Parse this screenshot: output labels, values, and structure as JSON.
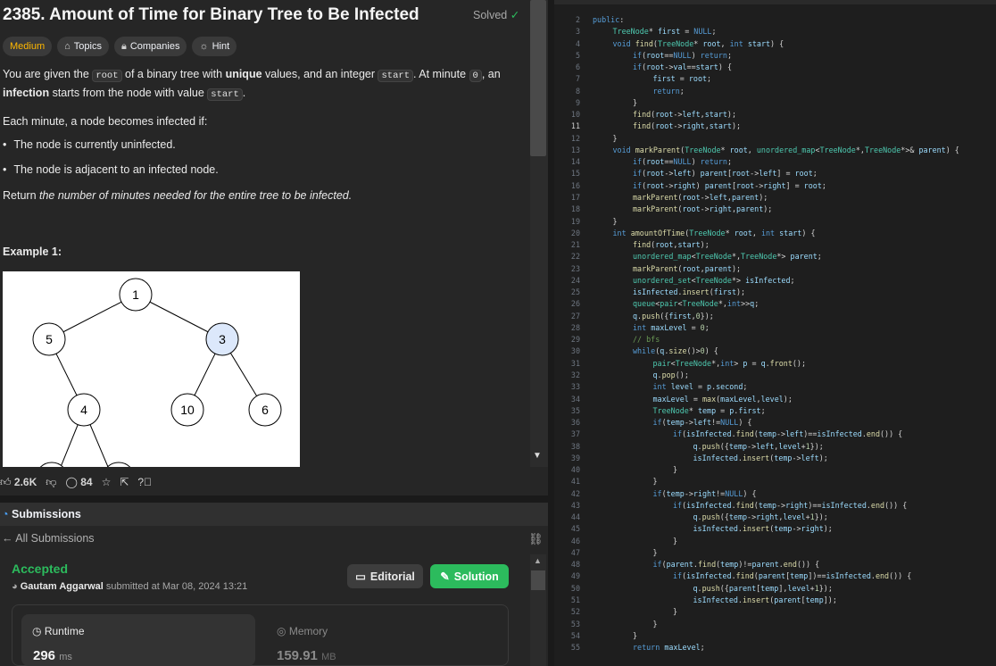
{
  "problem": {
    "title": "2385. Amount of Time for Binary Tree to Be Infected",
    "status": "Solved",
    "tags": [
      {
        "label": "Medium",
        "icon": ""
      },
      {
        "label": "Topics",
        "icon": "tag-icon"
      },
      {
        "label": "Companies",
        "icon": "lock-icon"
      },
      {
        "label": "Hint",
        "icon": "lightbulb-icon"
      }
    ],
    "desc": {
      "p1a": "You are given the ",
      "p1code1": "root",
      "p1b": " of a binary tree with ",
      "p1bold1": "unique",
      "p1c": " values, and an integer ",
      "p1code2": "start",
      "p1d": ". At minute ",
      "p1code3": "0",
      "p1e": ", an ",
      "p1bold2": "infection",
      "p1f": " starts from the node with value ",
      "p1code4": "start",
      "p1g": ".",
      "p2": "Each minute, a node becomes infected if:",
      "bullets": [
        "The node is currently uninfected.",
        "The node is adjacent to an infected node."
      ],
      "ret_a": "Return ",
      "ret_b": "the number of minutes needed for the entire tree to be infected."
    },
    "example_label": "Example 1:",
    "tree": {
      "nodes": [
        "1",
        "5",
        "3",
        "4",
        "10",
        "6"
      ],
      "infected_color": "#dce8fb"
    },
    "actions": {
      "likes": "2.6K",
      "comments": "84"
    }
  },
  "submission": {
    "header": "Submissions",
    "back_label": "All Submissions",
    "status": "Accepted",
    "author": "Gautam Aggarwal",
    "submitted_text": "submitted at Mar 08, 2024 13:21",
    "editorial_label": "Editorial",
    "solution_label": "Solution",
    "runtime_label": "Runtime",
    "runtime_value": "296",
    "runtime_unit": "ms",
    "memory_label": "Memory",
    "memory_value": "159.91",
    "memory_unit": "MB"
  },
  "editor": {
    "current_line": 11,
    "lines": [
      {
        "n": 2,
        "i": 0,
        "t": "public:"
      },
      {
        "n": 3,
        "i": 1,
        "t": "TreeNode* first = NULL;"
      },
      {
        "n": 4,
        "i": 1,
        "t": "void find(TreeNode* root, int start) {"
      },
      {
        "n": 5,
        "i": 2,
        "t": "if(root==NULL) return;"
      },
      {
        "n": 6,
        "i": 2,
        "t": "if(root->val==start) {"
      },
      {
        "n": 7,
        "i": 3,
        "t": "first = root;"
      },
      {
        "n": 8,
        "i": 3,
        "t": "return;"
      },
      {
        "n": 9,
        "i": 2,
        "t": "}"
      },
      {
        "n": 10,
        "i": 2,
        "t": "find(root->left,start);"
      },
      {
        "n": 11,
        "i": 2,
        "t": "find(root->right,start);"
      },
      {
        "n": 12,
        "i": 1,
        "t": "}"
      },
      {
        "n": 13,
        "i": 1,
        "t": "void markParent(TreeNode* root, unordered_map<TreeNode*,TreeNode*>& parent) {"
      },
      {
        "n": 14,
        "i": 2,
        "t": "if(root==NULL) return;"
      },
      {
        "n": 15,
        "i": 2,
        "t": "if(root->left) parent[root->left] = root;"
      },
      {
        "n": 16,
        "i": 2,
        "t": "if(root->right) parent[root->right] = root;"
      },
      {
        "n": 17,
        "i": 2,
        "t": "markParent(root->left,parent);"
      },
      {
        "n": 18,
        "i": 2,
        "t": "markParent(root->right,parent);"
      },
      {
        "n": 19,
        "i": 1,
        "t": "}"
      },
      {
        "n": 20,
        "i": 1,
        "t": "int amountOfTime(TreeNode* root, int start) {"
      },
      {
        "n": 21,
        "i": 2,
        "t": "find(root,start);"
      },
      {
        "n": 22,
        "i": 2,
        "t": "unordered_map<TreeNode*,TreeNode*> parent;"
      },
      {
        "n": 23,
        "i": 2,
        "t": "markParent(root,parent);"
      },
      {
        "n": 24,
        "i": 2,
        "t": "unordered_set<TreeNode*> isInfected;"
      },
      {
        "n": 25,
        "i": 2,
        "t": "isInfected.insert(first);"
      },
      {
        "n": 26,
        "i": 2,
        "t": "queue<pair<TreeNode*,int>>q;"
      },
      {
        "n": 27,
        "i": 2,
        "t": "q.push({first,0});"
      },
      {
        "n": 28,
        "i": 2,
        "t": "int maxLevel = 0;"
      },
      {
        "n": 29,
        "i": 2,
        "t": "// bfs"
      },
      {
        "n": 30,
        "i": 2,
        "t": "while(q.size()>0) {"
      },
      {
        "n": 31,
        "i": 3,
        "t": "pair<TreeNode*,int> p = q.front();"
      },
      {
        "n": 32,
        "i": 3,
        "t": "q.pop();"
      },
      {
        "n": 33,
        "i": 3,
        "t": "int level = p.second;"
      },
      {
        "n": 34,
        "i": 3,
        "t": "maxLevel = max(maxLevel,level);"
      },
      {
        "n": 35,
        "i": 3,
        "t": "TreeNode* temp = p.first;"
      },
      {
        "n": 36,
        "i": 3,
        "t": "if(temp->left!=NULL) {"
      },
      {
        "n": 37,
        "i": 4,
        "t": "if(isInfected.find(temp->left)==isInfected.end()) {"
      },
      {
        "n": 38,
        "i": 5,
        "t": "q.push({temp->left,level+1});"
      },
      {
        "n": 39,
        "i": 5,
        "t": "isInfected.insert(temp->left);"
      },
      {
        "n": 40,
        "i": 4,
        "t": "}"
      },
      {
        "n": 41,
        "i": 3,
        "t": "}"
      },
      {
        "n": 42,
        "i": 3,
        "t": "if(temp->right!=NULL) {"
      },
      {
        "n": 43,
        "i": 4,
        "t": "if(isInfected.find(temp->right)==isInfected.end()) {"
      },
      {
        "n": 44,
        "i": 5,
        "t": "q.push({temp->right,level+1});"
      },
      {
        "n": 45,
        "i": 5,
        "t": "isInfected.insert(temp->right);"
      },
      {
        "n": 46,
        "i": 4,
        "t": "}"
      },
      {
        "n": 47,
        "i": 3,
        "t": "}"
      },
      {
        "n": 48,
        "i": 3,
        "t": "if(parent.find(temp)!=parent.end()) {"
      },
      {
        "n": 49,
        "i": 4,
        "t": "if(isInfected.find(parent[temp])==isInfected.end()) {"
      },
      {
        "n": 50,
        "i": 5,
        "t": "q.push({parent[temp],level+1});"
      },
      {
        "n": 51,
        "i": 5,
        "t": "isInfected.insert(parent[temp]);"
      },
      {
        "n": 52,
        "i": 4,
        "t": "}"
      },
      {
        "n": 53,
        "i": 3,
        "t": "}"
      },
      {
        "n": 54,
        "i": 2,
        "t": "}"
      },
      {
        "n": 55,
        "i": 2,
        "t": "return maxLevel;"
      }
    ]
  },
  "colors": {
    "accent_green": "#2cbb5d",
    "medium": "#ffb800"
  }
}
